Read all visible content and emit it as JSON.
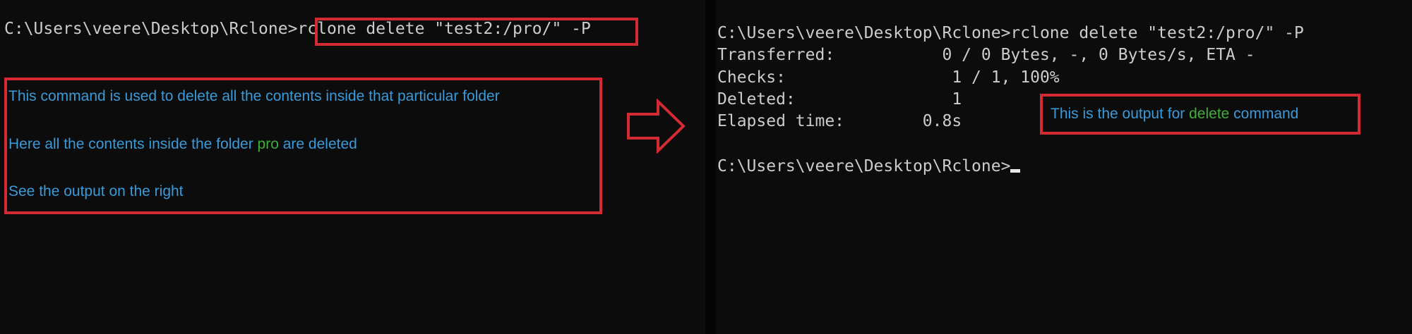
{
  "left": {
    "prompt": "C:\\Users\\veere\\Desktop\\Rclone>",
    "command": "rclone delete \"test2:/pro/\" -P",
    "notes": {
      "line1": "This command is used to delete all the contents inside that particular folder",
      "line2_pre": "Here all the contents inside the folder ",
      "line2_highlight": "pro",
      "line2_post": " are deleted",
      "line3": "See the output on the right"
    }
  },
  "right": {
    "command_line": "C:\\Users\\veere\\Desktop\\Rclone>rclone delete \"test2:/pro/\" -P",
    "output": [
      {
        "label": "Transferred:",
        "value": "           0 / 0 Bytes, -, 0 Bytes/s, ETA -"
      },
      {
        "label": "Checks:",
        "value": "                 1 / 1, 100%"
      },
      {
        "label": "Deleted:",
        "value": "                1"
      },
      {
        "label": "Elapsed time:",
        "value": "        0.8s"
      }
    ],
    "prompt": "C:\\Users\\veere\\Desktop\\Rclone>",
    "note": {
      "pre": "This is the output for ",
      "highlight": "delete",
      "post": " command"
    }
  },
  "colors": {
    "annotation_box": "#d42a32",
    "note_text": "#3b9ad9",
    "highlight": "#3fae3a",
    "terminal_bg": "#0c0c0c"
  }
}
